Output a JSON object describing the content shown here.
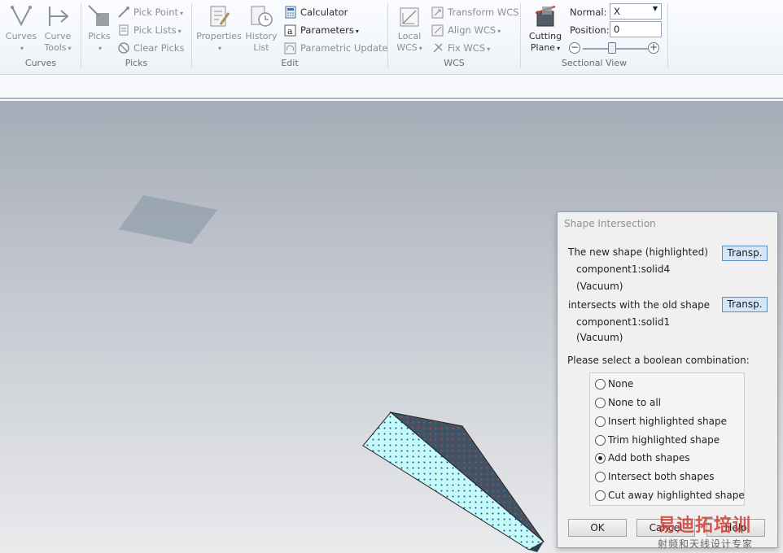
{
  "ribbon": {
    "curves": {
      "group_label": "Curves",
      "curves_btn": "Curves",
      "curve_tools_line1": "Curve",
      "curve_tools_line2": "Tools"
    },
    "picks": {
      "group_label": "Picks",
      "picks_btn": "Picks",
      "pick_point": "Pick Point",
      "pick_lists": "Pick Lists",
      "clear_picks": "Clear Picks"
    },
    "edit": {
      "group_label": "Edit",
      "properties": "Properties",
      "history_line1": "History",
      "history_line2": "List",
      "calculator": "Calculator",
      "parameters": "Parameters",
      "parametric_update": "Parametric Update"
    },
    "wcs": {
      "group_label": "WCS",
      "local_line1": "Local",
      "local_line2": "WCS",
      "transform_wcs": "Transform WCS",
      "align_wcs": "Align WCS",
      "fix_wcs": "Fix WCS"
    },
    "sectional": {
      "group_label": "Sectional View",
      "cutting_line1": "Cutting",
      "cutting_line2": "Plane",
      "normal_label": "Normal:",
      "normal_value": "X",
      "position_label": "Position:",
      "position_value": "0",
      "slider_fraction": 0.45
    }
  },
  "dialog": {
    "title": "Shape Intersection",
    "new_shape_label": "The new shape (highlighted)",
    "new_shape_name": "component1:solid4",
    "new_shape_material": "(Vacuum)",
    "old_shape_label": "intersects with the old shape",
    "old_shape_name": "component1:solid1",
    "old_shape_material": "(Vacuum)",
    "transp_label": "Transp.",
    "prompt": "Please select a boolean combination:",
    "options": [
      "None",
      "None to all",
      "Insert highlighted shape",
      "Trim highlighted shape",
      "Add both shapes",
      "Intersect both shapes",
      "Cut away highlighted shape"
    ],
    "selected_option": "Add both shapes",
    "ok": "OK",
    "cancel": "Cancel",
    "help": "Help"
  },
  "watermark": {
    "line1": "易迪拓培训",
    "line2": "射频和天线设计专家"
  },
  "colors": {
    "shape_face_light": "#c4fafa",
    "shape_face_dark": "#3d5566",
    "viewport_top": "#a5acb7",
    "viewport_bottom": "#e9eaec"
  }
}
